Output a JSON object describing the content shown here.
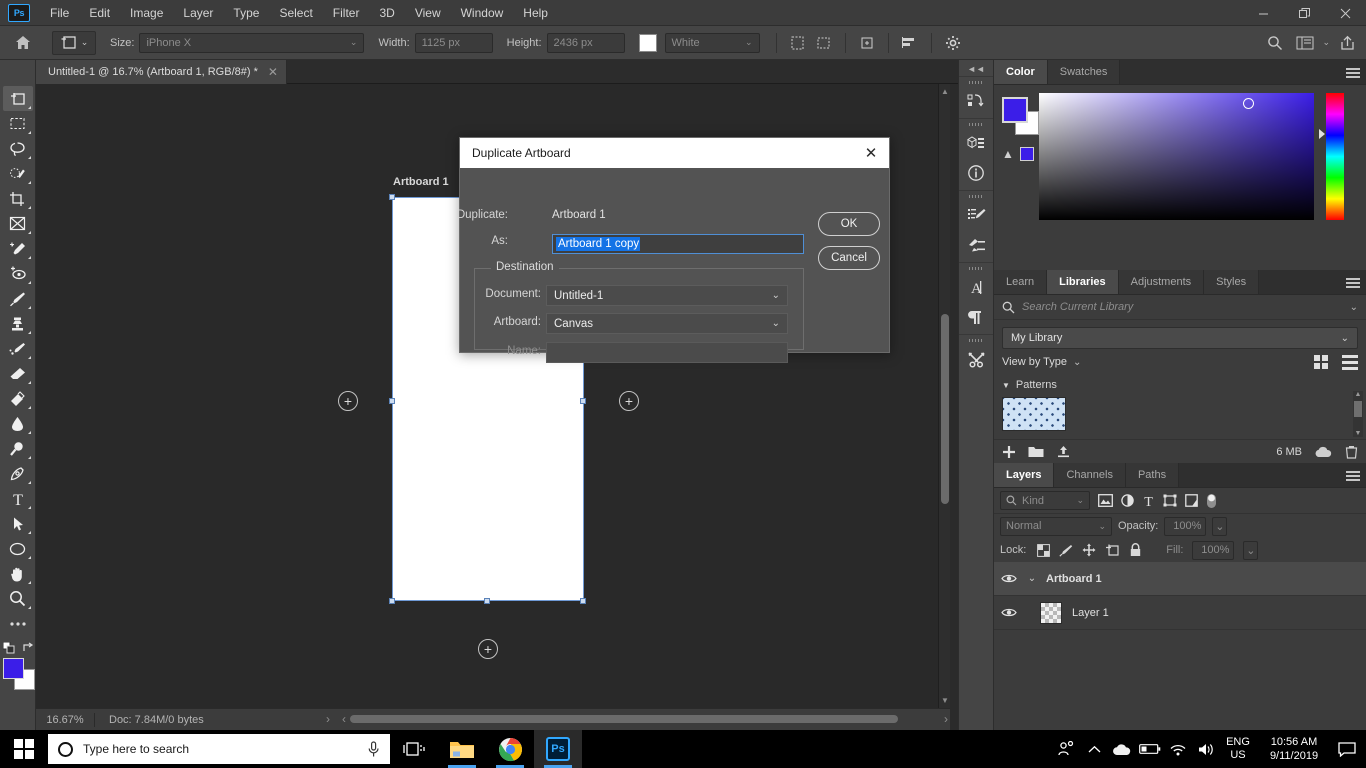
{
  "app": {
    "logo": "Ps",
    "menu": [
      "File",
      "Edit",
      "Image",
      "Layer",
      "Type",
      "Select",
      "Filter",
      "3D",
      "View",
      "Window",
      "Help"
    ],
    "window_controls": {
      "minimize": "—",
      "maximize": "❐",
      "close": "✕"
    }
  },
  "options_bar": {
    "size_label": "Size:",
    "size_value": "iPhone X",
    "width_label": "Width:",
    "width_value": "1125 px",
    "height_label": "Height:",
    "height_value": "2436 px",
    "background_value": "White"
  },
  "document_tab": {
    "title": "Untitled-1 @ 16.7% (Artboard 1, RGB/8#) *",
    "close": "✕"
  },
  "canvas": {
    "artboard_label": "Artboard 1",
    "plus_glyph": "+"
  },
  "status_bar": {
    "zoom": "16.67%",
    "doc": "Doc: 7.84M/0 bytes",
    "arrow_right": "›",
    "arrow_left": "‹"
  },
  "dialog": {
    "title": "Duplicate Artboard",
    "close_glyph": "✕",
    "duplicate_label": "Duplicate:",
    "duplicate_value": "Artboard 1",
    "as_label": "As:",
    "as_value": "Artboard 1 copy",
    "destination_legend": "Destination",
    "document_label": "Document:",
    "document_value": "Untitled-1",
    "artboard_label": "Artboard:",
    "artboard_value": "Canvas",
    "name_label": "Name:",
    "name_value": "",
    "ok_label": "OK",
    "cancel_label": "Cancel",
    "chevron": "⌄"
  },
  "color_panel": {
    "tabs": [
      {
        "label": "Color",
        "active": true
      },
      {
        "label": "Swatches",
        "active": false
      }
    ],
    "foreground_color": "#3b1ee8",
    "background_color": "#ffffff",
    "out_of_gamut_glyph": "▲"
  },
  "libraries_panel": {
    "tabs": [
      {
        "label": "Learn",
        "active": false
      },
      {
        "label": "Libraries",
        "active": true
      },
      {
        "label": "Adjustments",
        "active": false
      },
      {
        "label": "Styles",
        "active": false
      }
    ],
    "search_placeholder": "Search Current Library",
    "library_select": "My Library",
    "view_by": "View by Type",
    "section_title": "Patterns",
    "size_text": "6 MB"
  },
  "layers_panel": {
    "tabs": [
      {
        "label": "Layers",
        "active": true
      },
      {
        "label": "Channels",
        "active": false
      },
      {
        "label": "Paths",
        "active": false
      }
    ],
    "kind_placeholder": "Kind",
    "blend_mode": "Normal",
    "opacity_label": "Opacity:",
    "opacity_value": "100%",
    "lock_label": "Lock:",
    "fill_label": "Fill:",
    "fill_value": "100%",
    "rows": [
      {
        "name": "Artboard 1",
        "type": "group",
        "selected": true,
        "visible": true
      },
      {
        "name": "Layer 1",
        "type": "layer",
        "selected": false,
        "visible": true
      }
    ]
  },
  "taskbar": {
    "search_placeholder": "Type here to search",
    "language_line1": "ENG",
    "language_line2": "US",
    "time": "10:56 AM",
    "date": "9/11/2019"
  }
}
